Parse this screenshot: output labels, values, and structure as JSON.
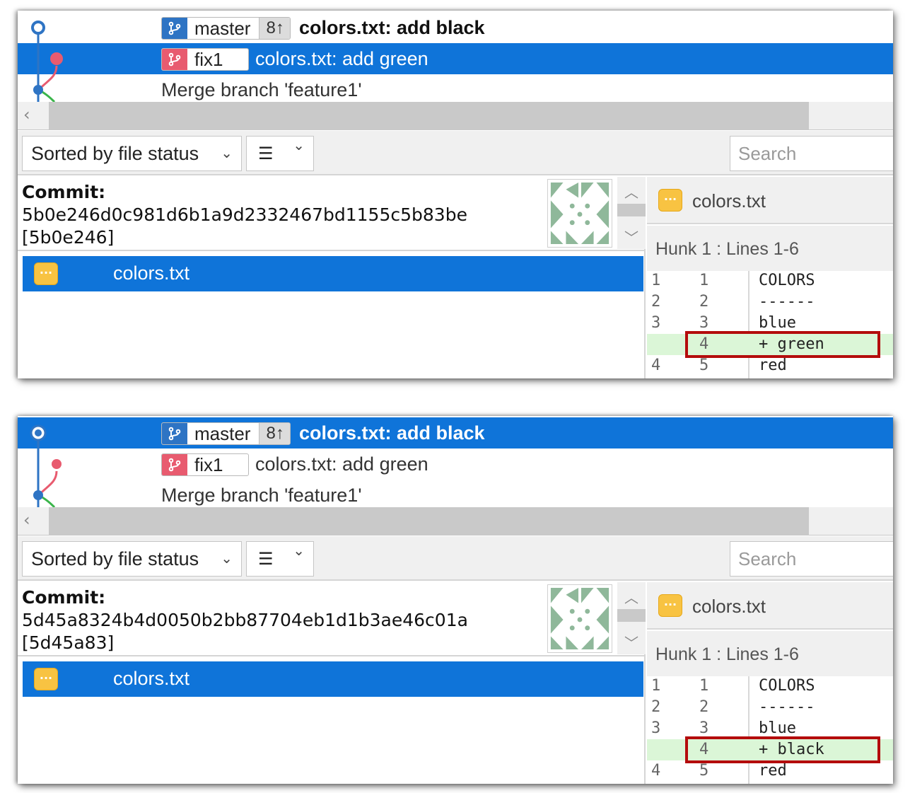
{
  "screens": [
    {
      "log": {
        "rows": [
          {
            "branch": "master",
            "ahead": "8↑",
            "message": "colors.txt: add black"
          },
          {
            "branch": "fix1",
            "message": "colors.txt: add green"
          },
          {
            "message": "Merge branch 'feature1'"
          }
        ],
        "selected_row": 1
      },
      "toolbar": {
        "sort_label": "Sorted by file status",
        "search_placeholder": "Search"
      },
      "commit": {
        "label": "Commit:",
        "hash": "5b0e246d0c981d6b1a9d2332467bd1155c5b83be",
        "short_hash": "[5b0e246]"
      },
      "files": [
        {
          "name": "colors.txt",
          "status_icon": "modified-icon"
        }
      ],
      "diff": {
        "file": "colors.txt",
        "hunk": "Hunk 1 : Lines 1-6",
        "lines": [
          {
            "old": "1",
            "new": "1",
            "code": "COLORS"
          },
          {
            "old": "2",
            "new": "2",
            "code": "------"
          },
          {
            "old": "3",
            "new": "3",
            "code": "blue"
          },
          {
            "old": "",
            "new": "4",
            "code": "+ green",
            "added": true
          },
          {
            "old": "4",
            "new": "5",
            "code": "red"
          }
        ]
      }
    },
    {
      "log": {
        "rows": [
          {
            "branch": "master",
            "ahead": "8↑",
            "message": "colors.txt: add black"
          },
          {
            "branch": "fix1",
            "message": "colors.txt: add green"
          },
          {
            "message": "Merge branch 'feature1'"
          }
        ],
        "selected_row": 0
      },
      "toolbar": {
        "sort_label": "Sorted by file status",
        "search_placeholder": "Search"
      },
      "commit": {
        "label": "Commit:",
        "hash": "5d45a8324b4d0050b2bb87704eb1d1b3ae46c01a",
        "short_hash": "[5d45a83]"
      },
      "files": [
        {
          "name": "colors.txt",
          "status_icon": "modified-icon"
        }
      ],
      "diff": {
        "file": "colors.txt",
        "hunk": "Hunk 1 : Lines 1-6",
        "lines": [
          {
            "old": "1",
            "new": "1",
            "code": "COLORS"
          },
          {
            "old": "2",
            "new": "2",
            "code": "------"
          },
          {
            "old": "3",
            "new": "3",
            "code": "blue"
          },
          {
            "old": "",
            "new": "4",
            "code": "+ black",
            "added": true
          },
          {
            "old": "4",
            "new": "5",
            "code": "red"
          }
        ]
      }
    }
  ],
  "colors": {
    "selection": "#0f74d9",
    "master_branch": "#2e74c4",
    "fix1_branch": "#e85b6f",
    "added_line": "#dbf6d7",
    "highlight_box": "#b40c0c"
  }
}
